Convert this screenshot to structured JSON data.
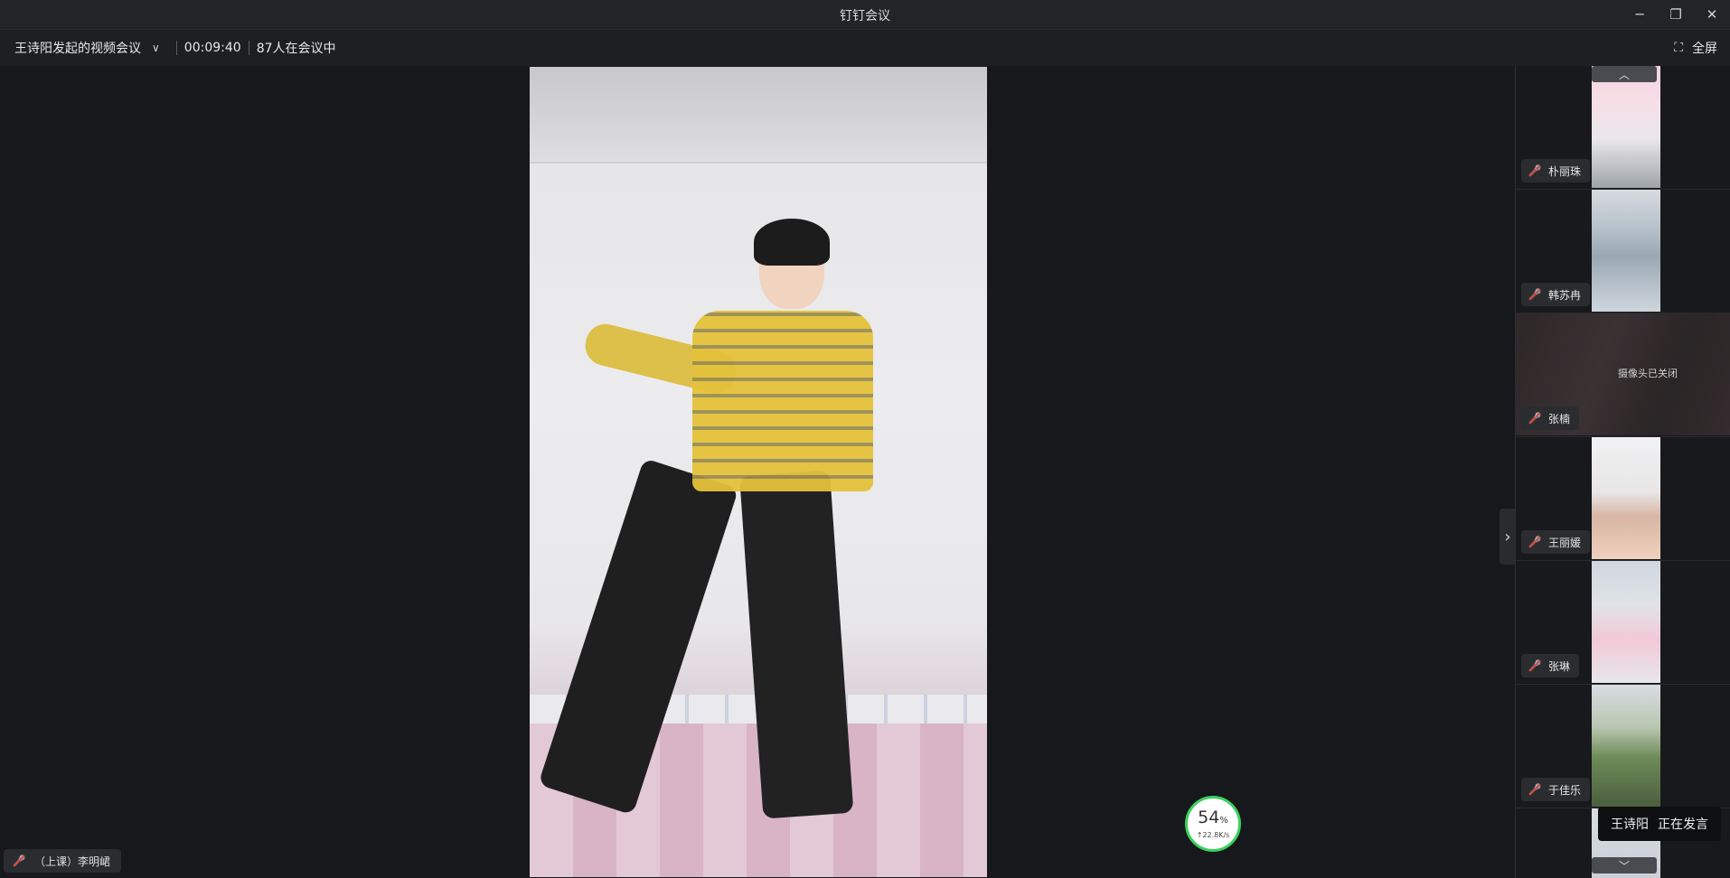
{
  "window": {
    "title": "钉钉会议",
    "minimize_icon": "─",
    "restore_icon": "❐",
    "close_icon": "✕"
  },
  "infobar": {
    "meeting_name": "王诗阳发起的视频会议",
    "chevron": "∨",
    "elapsed": "00:09:40",
    "participants": "87人在会议中",
    "fullscreen_label": "全屏",
    "fullscreen_icon": "⛶"
  },
  "stage": {
    "speaker_label": "（上课）李明峮",
    "collapse_icon": "›"
  },
  "network": {
    "percent": "54",
    "percent_unit": "%",
    "rate": "↑22.8K/s",
    "ring_color": "#3bd15f"
  },
  "panel": {
    "scroll_up_icon": "︿",
    "scroll_down_icon": "﹀",
    "participants": [
      {
        "name": "朴丽珠"
      },
      {
        "name": "韩苏冉"
      },
      {
        "name": "张楠",
        "camera_off": "摄像头已关闭"
      },
      {
        "name": "王丽媛"
      },
      {
        "name": "张琳"
      },
      {
        "name": "于佳乐"
      }
    ]
  },
  "toast": {
    "speaker": "王诗阳",
    "status": "正在发言"
  },
  "mic_icon": "🎤",
  "colors": {
    "background": "#17181b",
    "mute_red": "#e0473f",
    "network_green": "#3bd15f"
  }
}
